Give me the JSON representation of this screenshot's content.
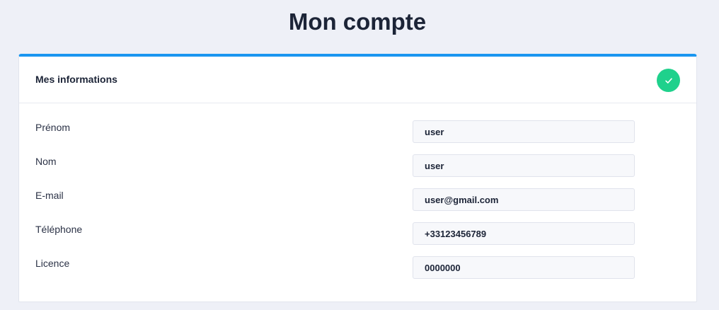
{
  "page": {
    "title": "Mon compte"
  },
  "card": {
    "title": "Mes informations",
    "status_icon": "check-circle-icon",
    "accent_color": "#1a96f0",
    "status_color": "#1fd18c"
  },
  "fields": [
    {
      "label": "Prénom",
      "value": "user"
    },
    {
      "label": "Nom",
      "value": "user"
    },
    {
      "label": "E-mail",
      "value": "user@gmail.com"
    },
    {
      "label": "Téléphone",
      "value": "+33123456789"
    },
    {
      "label": "Licence",
      "value": "0000000"
    }
  ]
}
